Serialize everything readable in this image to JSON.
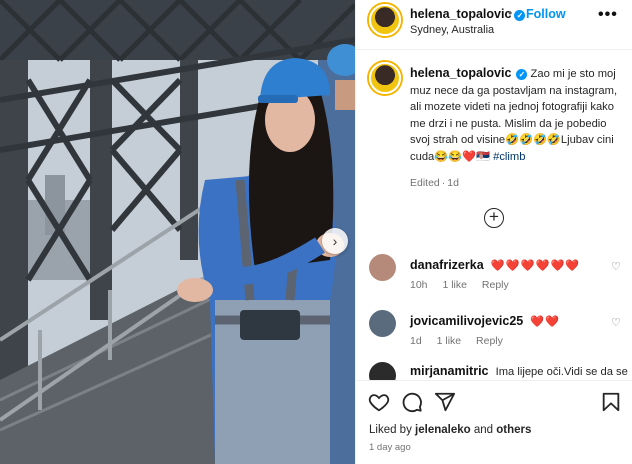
{
  "post": {
    "username": "helena_topalovic",
    "verified_mark": "✓",
    "separator": "•",
    "follow_label": "Follow",
    "location": "Sydney, Australia",
    "more_label": "•••",
    "next_arrow": "›",
    "photo_alt": "Woman in blue climbing suit on Sydney Harbour Bridge"
  },
  "caption": {
    "username": "helena_topalovic",
    "text": "Zao mi je sto moj muz nece da ga postavljam na instagram, ali mozete videti na jednoj fotografiji kako me drzi i ne pusta. Mislim da je pobedio svoj strah od visine🤣🤣🤣🤣Ljubav cini cuda😂😂❤️🇷🇸",
    "hashtag": "#climb",
    "edited_label": "Edited",
    "edited_dot": "·",
    "edited_time": "1d",
    "load_more_label": "+"
  },
  "comments": [
    {
      "username": "danafrizerka",
      "text": "❤️❤️❤️❤️❤️❤️",
      "time": "10h",
      "likes": "1 like",
      "reply": "Reply",
      "heart": "♡",
      "avatar_color": "#b58a7a"
    },
    {
      "username": "jovicamilivojevic25",
      "text": "❤️❤️",
      "time": "1d",
      "likes": "1 like",
      "reply": "Reply",
      "heart": "♡",
      "avatar_color": "#5a6b7d"
    },
    {
      "username": "mirjanamitric",
      "text": "Ima lijepe oči.Vidi se da se",
      "time": "",
      "likes": "",
      "reply": "",
      "heart": "",
      "avatar_color": "#2b2b2b"
    }
  ],
  "actions": {
    "like_icon": "heart-icon",
    "comment_icon": "comment-icon",
    "share_icon": "share-icon",
    "save_icon": "bookmark-icon"
  },
  "likes": {
    "prefix": "Liked by",
    "user": "jelenaleko",
    "and": "and",
    "others": "others"
  },
  "time_ago": "1 day ago",
  "colors": {
    "accent": "#0095f6",
    "heart": "#ed1c24",
    "hashtag": "#00376b",
    "muted": "#737373"
  }
}
